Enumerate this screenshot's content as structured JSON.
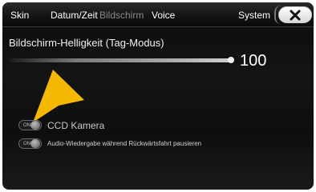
{
  "tabs": [
    {
      "label": "Skin",
      "active": true
    },
    {
      "label": "Datum/Zeit",
      "active": true
    },
    {
      "label": "Bildschirm",
      "active": false
    },
    {
      "label": "Voice",
      "active": true
    },
    {
      "label": "System",
      "active": true
    }
  ],
  "close_icon": "close-icon",
  "brightness": {
    "title": "Bildschirm-Helligkeit (Tag-Modus)",
    "value": "100",
    "level": 1.0
  },
  "settings": [
    {
      "label": "CCD Kamera",
      "toggle_text": "ON"
    },
    {
      "label": "Audio-Wiedergabe während Rückwärtsfahrt pausieren",
      "toggle_text": "ON"
    }
  ],
  "colors": {
    "arrow": "#f5b800",
    "background": "#111111",
    "text": "#ffffff"
  }
}
